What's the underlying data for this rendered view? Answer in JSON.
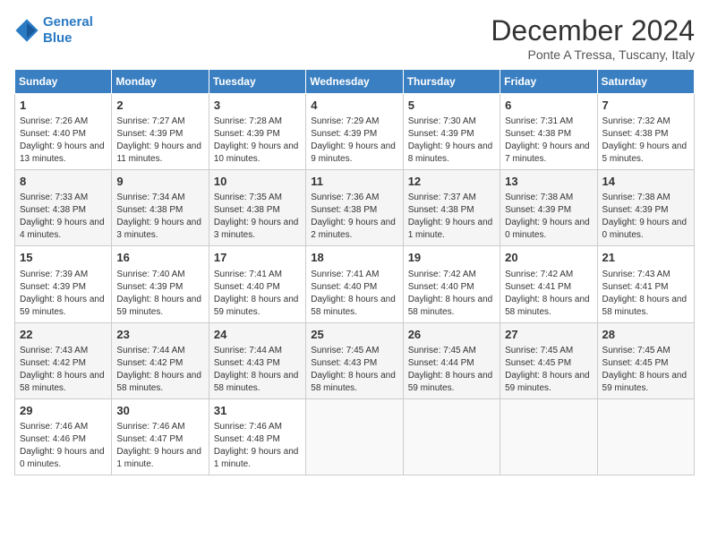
{
  "header": {
    "logo_line1": "General",
    "logo_line2": "Blue",
    "month_title": "December 2024",
    "location": "Ponte A Tressa, Tuscany, Italy"
  },
  "weekdays": [
    "Sunday",
    "Monday",
    "Tuesday",
    "Wednesday",
    "Thursday",
    "Friday",
    "Saturday"
  ],
  "weeks": [
    [
      {
        "day": "1",
        "sunrise": "Sunrise: 7:26 AM",
        "sunset": "Sunset: 4:40 PM",
        "daylight": "Daylight: 9 hours and 13 minutes."
      },
      {
        "day": "2",
        "sunrise": "Sunrise: 7:27 AM",
        "sunset": "Sunset: 4:39 PM",
        "daylight": "Daylight: 9 hours and 11 minutes."
      },
      {
        "day": "3",
        "sunrise": "Sunrise: 7:28 AM",
        "sunset": "Sunset: 4:39 PM",
        "daylight": "Daylight: 9 hours and 10 minutes."
      },
      {
        "day": "4",
        "sunrise": "Sunrise: 7:29 AM",
        "sunset": "Sunset: 4:39 PM",
        "daylight": "Daylight: 9 hours and 9 minutes."
      },
      {
        "day": "5",
        "sunrise": "Sunrise: 7:30 AM",
        "sunset": "Sunset: 4:39 PM",
        "daylight": "Daylight: 9 hours and 8 minutes."
      },
      {
        "day": "6",
        "sunrise": "Sunrise: 7:31 AM",
        "sunset": "Sunset: 4:38 PM",
        "daylight": "Daylight: 9 hours and 7 minutes."
      },
      {
        "day": "7",
        "sunrise": "Sunrise: 7:32 AM",
        "sunset": "Sunset: 4:38 PM",
        "daylight": "Daylight: 9 hours and 5 minutes."
      }
    ],
    [
      {
        "day": "8",
        "sunrise": "Sunrise: 7:33 AM",
        "sunset": "Sunset: 4:38 PM",
        "daylight": "Daylight: 9 hours and 4 minutes."
      },
      {
        "day": "9",
        "sunrise": "Sunrise: 7:34 AM",
        "sunset": "Sunset: 4:38 PM",
        "daylight": "Daylight: 9 hours and 3 minutes."
      },
      {
        "day": "10",
        "sunrise": "Sunrise: 7:35 AM",
        "sunset": "Sunset: 4:38 PM",
        "daylight": "Daylight: 9 hours and 3 minutes."
      },
      {
        "day": "11",
        "sunrise": "Sunrise: 7:36 AM",
        "sunset": "Sunset: 4:38 PM",
        "daylight": "Daylight: 9 hours and 2 minutes."
      },
      {
        "day": "12",
        "sunrise": "Sunrise: 7:37 AM",
        "sunset": "Sunset: 4:38 PM",
        "daylight": "Daylight: 9 hours and 1 minute."
      },
      {
        "day": "13",
        "sunrise": "Sunrise: 7:38 AM",
        "sunset": "Sunset: 4:39 PM",
        "daylight": "Daylight: 9 hours and 0 minutes."
      },
      {
        "day": "14",
        "sunrise": "Sunrise: 7:38 AM",
        "sunset": "Sunset: 4:39 PM",
        "daylight": "Daylight: 9 hours and 0 minutes."
      }
    ],
    [
      {
        "day": "15",
        "sunrise": "Sunrise: 7:39 AM",
        "sunset": "Sunset: 4:39 PM",
        "daylight": "Daylight: 8 hours and 59 minutes."
      },
      {
        "day": "16",
        "sunrise": "Sunrise: 7:40 AM",
        "sunset": "Sunset: 4:39 PM",
        "daylight": "Daylight: 8 hours and 59 minutes."
      },
      {
        "day": "17",
        "sunrise": "Sunrise: 7:41 AM",
        "sunset": "Sunset: 4:40 PM",
        "daylight": "Daylight: 8 hours and 59 minutes."
      },
      {
        "day": "18",
        "sunrise": "Sunrise: 7:41 AM",
        "sunset": "Sunset: 4:40 PM",
        "daylight": "Daylight: 8 hours and 58 minutes."
      },
      {
        "day": "19",
        "sunrise": "Sunrise: 7:42 AM",
        "sunset": "Sunset: 4:40 PM",
        "daylight": "Daylight: 8 hours and 58 minutes."
      },
      {
        "day": "20",
        "sunrise": "Sunrise: 7:42 AM",
        "sunset": "Sunset: 4:41 PM",
        "daylight": "Daylight: 8 hours and 58 minutes."
      },
      {
        "day": "21",
        "sunrise": "Sunrise: 7:43 AM",
        "sunset": "Sunset: 4:41 PM",
        "daylight": "Daylight: 8 hours and 58 minutes."
      }
    ],
    [
      {
        "day": "22",
        "sunrise": "Sunrise: 7:43 AM",
        "sunset": "Sunset: 4:42 PM",
        "daylight": "Daylight: 8 hours and 58 minutes."
      },
      {
        "day": "23",
        "sunrise": "Sunrise: 7:44 AM",
        "sunset": "Sunset: 4:42 PM",
        "daylight": "Daylight: 8 hours and 58 minutes."
      },
      {
        "day": "24",
        "sunrise": "Sunrise: 7:44 AM",
        "sunset": "Sunset: 4:43 PM",
        "daylight": "Daylight: 8 hours and 58 minutes."
      },
      {
        "day": "25",
        "sunrise": "Sunrise: 7:45 AM",
        "sunset": "Sunset: 4:43 PM",
        "daylight": "Daylight: 8 hours and 58 minutes."
      },
      {
        "day": "26",
        "sunrise": "Sunrise: 7:45 AM",
        "sunset": "Sunset: 4:44 PM",
        "daylight": "Daylight: 8 hours and 59 minutes."
      },
      {
        "day": "27",
        "sunrise": "Sunrise: 7:45 AM",
        "sunset": "Sunset: 4:45 PM",
        "daylight": "Daylight: 8 hours and 59 minutes."
      },
      {
        "day": "28",
        "sunrise": "Sunrise: 7:45 AM",
        "sunset": "Sunset: 4:45 PM",
        "daylight": "Daylight: 8 hours and 59 minutes."
      }
    ],
    [
      {
        "day": "29",
        "sunrise": "Sunrise: 7:46 AM",
        "sunset": "Sunset: 4:46 PM",
        "daylight": "Daylight: 9 hours and 0 minutes."
      },
      {
        "day": "30",
        "sunrise": "Sunrise: 7:46 AM",
        "sunset": "Sunset: 4:47 PM",
        "daylight": "Daylight: 9 hours and 1 minute."
      },
      {
        "day": "31",
        "sunrise": "Sunrise: 7:46 AM",
        "sunset": "Sunset: 4:48 PM",
        "daylight": "Daylight: 9 hours and 1 minute."
      },
      null,
      null,
      null,
      null
    ]
  ]
}
